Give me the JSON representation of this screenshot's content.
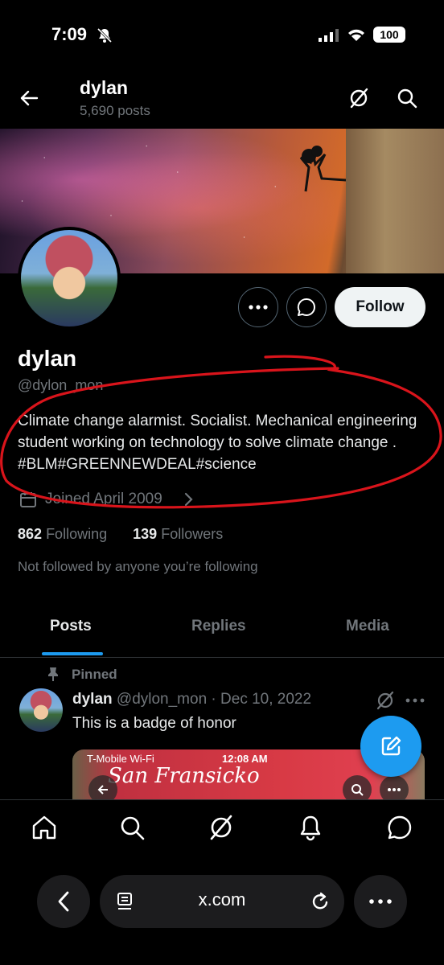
{
  "status_bar": {
    "time": "7:09",
    "battery": "100"
  },
  "header": {
    "name": "dylan",
    "posts": "5,690 posts"
  },
  "profile": {
    "name": "dylan",
    "handle": "@dylon_mon",
    "bio": "Climate change alarmist. Socialist. Mechanical engineering student working on technology to solve climate change . #BLM#GREENNEWDEAL#science",
    "joined": "Joined April 2009",
    "following_count": "862",
    "following_label": "Following",
    "followers_count": "139",
    "followers_label": "Followers",
    "not_followed": "Not followed by anyone you’re following",
    "follow_label": "Follow"
  },
  "tabs": [
    {
      "label": "Posts",
      "active": true
    },
    {
      "label": "Replies",
      "active": false
    },
    {
      "label": "Media",
      "active": false
    }
  ],
  "pinned_post": {
    "pinned_label": "Pinned",
    "author": "dylan",
    "meta": "@dylon_mon · Dec 10, 2022",
    "text": "This is a badge of honor",
    "media_status": "T-Mobile Wi-Fi",
    "media_time": "12:08 AM",
    "media_sign": "San Fransicko"
  },
  "browser": {
    "url": "x.com"
  },
  "colors": {
    "accent": "#1d9bf0",
    "annotation": "#d9141b",
    "background": "#000000"
  }
}
